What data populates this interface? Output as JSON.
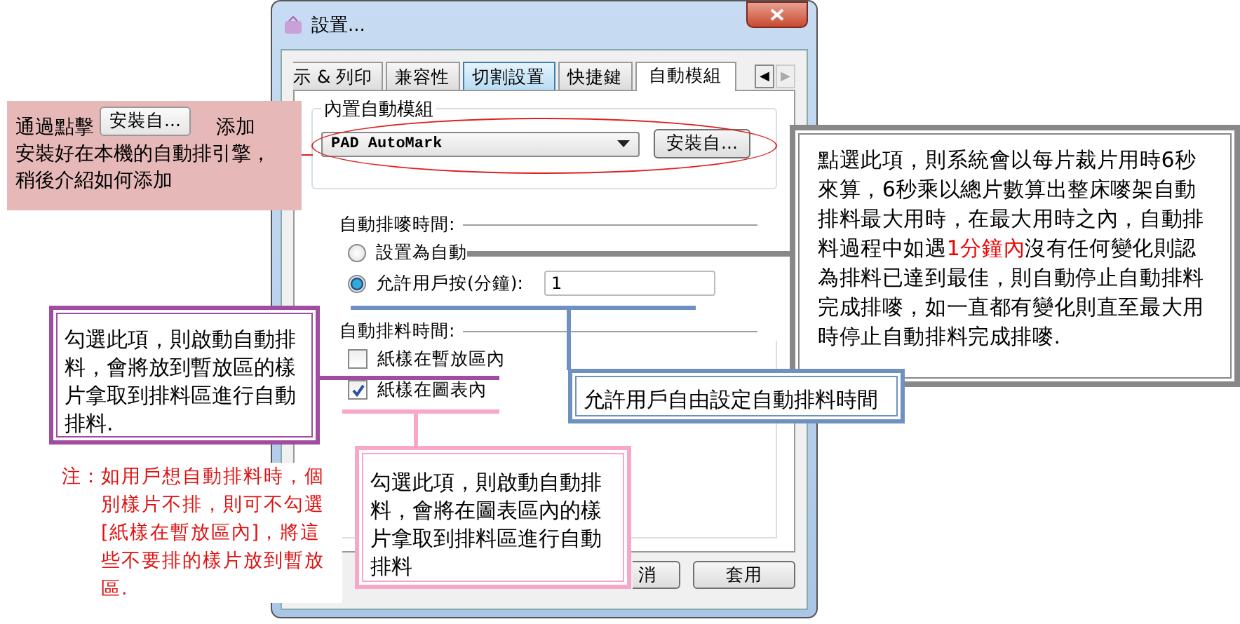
{
  "window": {
    "title": "設置..."
  },
  "tabs": [
    {
      "label": "示 & 列印",
      "selected": false,
      "hovered": false
    },
    {
      "label": "兼容性",
      "selected": false,
      "hovered": false
    },
    {
      "label": "切割設置",
      "selected": false,
      "hovered": true
    },
    {
      "label": "快捷鍵",
      "selected": false,
      "hovered": false
    },
    {
      "label": "自動模組",
      "selected": true,
      "hovered": false
    }
  ],
  "tab_scroll": [
    {
      "symbol": "◀",
      "disabled": false
    },
    {
      "symbol": "▶",
      "disabled": true
    }
  ],
  "builtin_group": {
    "title": "內置自動模組",
    "combo_value": "PAD AutoMark",
    "install_button": "安裝自..."
  },
  "marker_time": {
    "title": "自動排嘜時間:",
    "options": [
      {
        "label": "設置為自動",
        "selected": false
      },
      {
        "label": "允許用戶按(分鐘):",
        "selected": true
      }
    ],
    "minutes_value": "1"
  },
  "nesting_time": {
    "title": "自動排料時間:",
    "options": [
      {
        "label": "紙樣在暫放區內",
        "checked": false
      },
      {
        "label": "紙樣在圖表內",
        "checked": true
      }
    ]
  },
  "buttons": [
    "消",
    "套用"
  ],
  "callouts": [
    {
      "kind": "install",
      "before": "通過點擊",
      "button": "安裝自...",
      "after": "添加",
      "rest": [
        "安裝好在本機的自動排引擎，",
        "稍後介紹如何添加"
      ]
    },
    {
      "kind": "auto",
      "before": "點選此項，則系統會以每片裁片用時6秒來算，6秒乘以總片數算出整床嘜架自動排料最大用時，在最大用時之內，自動排料過程中如遇",
      "highlight": "1分鐘內",
      "after": "沒有任何變化則認為排料已達到最佳，則自動停止自動排料完成排嘜，如一直都有變化則直至最大用時停止自動排料完成排嘜."
    },
    {
      "kind": "user",
      "text": "允許用戶自由設定自動排料時間"
    },
    {
      "kind": "hold",
      "text": "勾選此項，則啟動自動排料，會將放到暫放區的樣片拿取到排料區進行自動排料."
    },
    {
      "kind": "chart",
      "text": "勾選此項，則啟動自動排料，會將在圖表區內的樣片拿取到排料區進行自動排料"
    }
  ],
  "note": {
    "label": "注：",
    "text": "如用戶想自動排料時，個別樣片不排，則可不勾選[紙樣在暫放區內]，將這些不要排的樣片放到暫放區."
  }
}
